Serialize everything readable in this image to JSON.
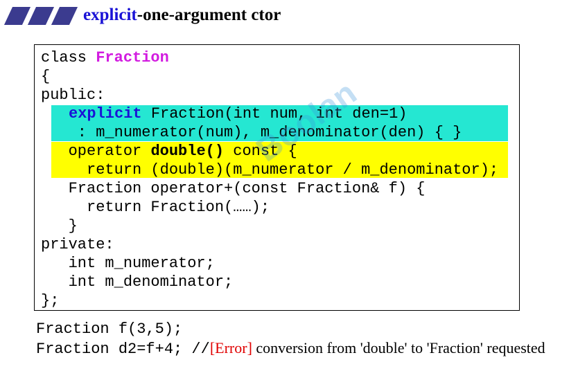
{
  "title": {
    "keyword": "explicit",
    "rest": "-one-argument ctor"
  },
  "code": {
    "l1_class": "class ",
    "l1_name": "Fraction",
    "l2": "{",
    "l3": "public:",
    "l4_kw": "explicit",
    "l4_rest": " Fraction(int num, int den=1)",
    "l5": "    : m_numerator(num), m_denominator(den) { }",
    "l6_a": "   operator ",
    "l6_b": "double()",
    "l6_c": " const {",
    "l7": "     return (double)(m_numerator / m_denominator);",
    "l8": "   Fraction operator+(const Fraction& f) {",
    "l9": "     return Fraction(……);",
    "l10": "   }",
    "l11": "private:",
    "l12": "   int m_numerator;",
    "l13": "   int m_denominator;",
    "l14": "};"
  },
  "usage": {
    "line1": "Fraction f(3,5);",
    "line2_code": "Fraction d2=f+4; //",
    "line2_error": "[Error]",
    "line2_msg": " conversion from 'double' to 'Fraction' requested"
  },
  "watermark": {
    "logo": "Boolan"
  }
}
